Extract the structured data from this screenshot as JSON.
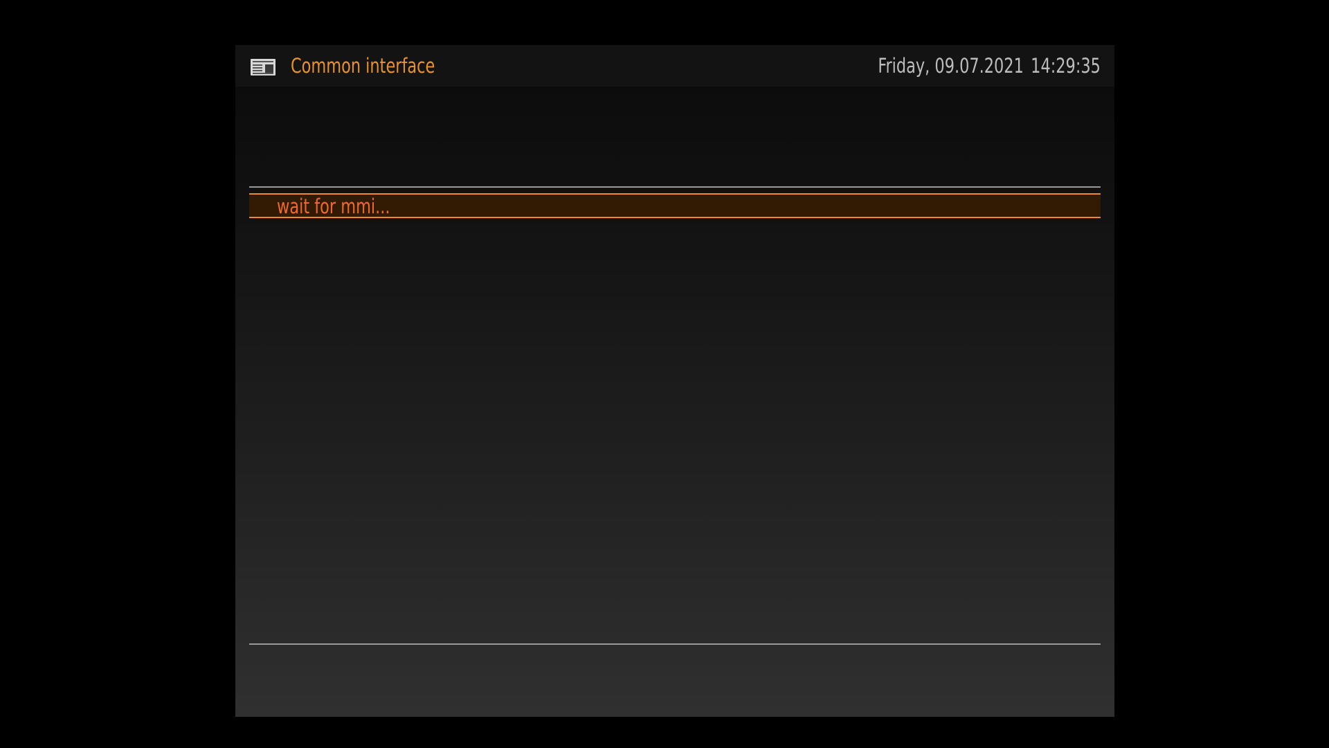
{
  "header": {
    "icon": "newspaper-icon",
    "title": "Common interface",
    "date": "Friday, 09.07.2021",
    "time": "14:29:35"
  },
  "menu": {
    "items": [
      {
        "label": "wait for mmi...",
        "selected": true
      }
    ]
  },
  "colors": {
    "accent": "#e8922c",
    "selected_text": "#f06a30",
    "selected_background": "#331a03",
    "selected_border": "#f08a2a",
    "clock_text": "#bdbdbd"
  }
}
